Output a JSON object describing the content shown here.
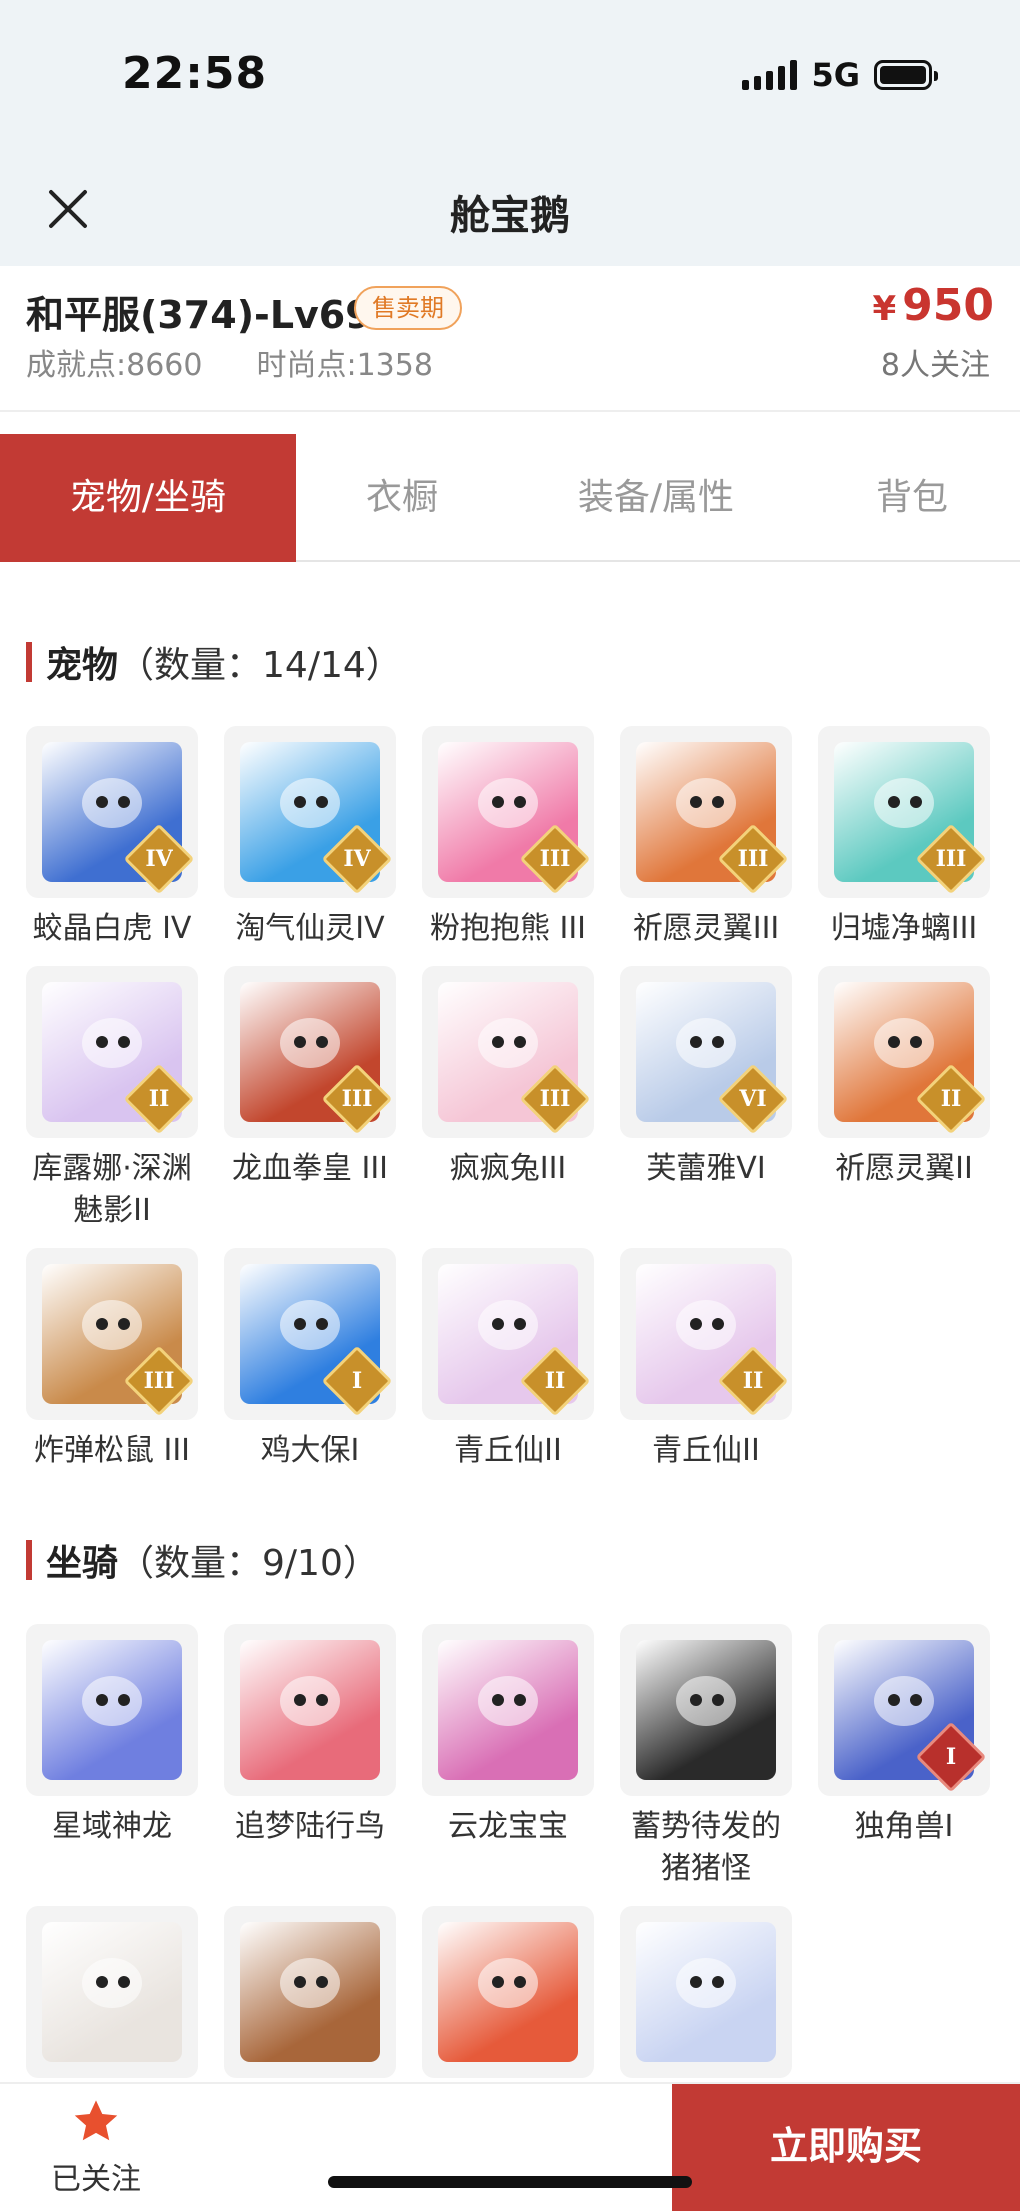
{
  "status_bar": {
    "time": "22:58",
    "network": "5G"
  },
  "nav": {
    "title": "舱宝鹅"
  },
  "listing": {
    "server_title": "和平服(374)-Lv69",
    "status_badge": "售卖期",
    "achievement_label": "成就点:",
    "achievement_value": "8660",
    "fashion_label": "时尚点:",
    "fashion_value": "1358",
    "price_currency": "¥",
    "price": "950",
    "followers": "8人关注"
  },
  "tabs": [
    {
      "label": "宠物/坐骑",
      "active": true
    },
    {
      "label": "衣橱",
      "active": false
    },
    {
      "label": "装备/属性",
      "active": false
    },
    {
      "label": "背包",
      "active": false
    }
  ],
  "pets_section": {
    "name": "宠物",
    "count": "（数量：14/14）"
  },
  "pets": [
    {
      "name": "蛟晶白虎 IV",
      "grade": "IV",
      "color": "#3f6fd1"
    },
    {
      "name": "淘气仙灵IV",
      "grade": "IV",
      "color": "#3aa0e6"
    },
    {
      "name": "粉抱抱熊 III",
      "grade": "III",
      "color": "#f07aa8"
    },
    {
      "name": "祈愿灵翼III",
      "grade": "III",
      "color": "#e0763a"
    },
    {
      "name": "归墟净螭III",
      "grade": "III",
      "color": "#5cc9c0"
    },
    {
      "name": "库露娜·深渊魅影II",
      "grade": "II",
      "color": "#d9c4f0"
    },
    {
      "name": "龙血拳皇 III",
      "grade": "III",
      "color": "#c2462d"
    },
    {
      "name": "疯疯兔III",
      "grade": "III",
      "color": "#f5c6d6"
    },
    {
      "name": "芙蕾雅VI",
      "grade": "VI",
      "color": "#b9cbe8"
    },
    {
      "name": "祈愿灵翼II",
      "grade": "II",
      "color": "#e0763a"
    },
    {
      "name": "炸弹松鼠 III",
      "grade": "III",
      "color": "#c98a4a"
    },
    {
      "name": "鸡大保I",
      "grade": "I",
      "color": "#2f7fe0"
    },
    {
      "name": "青丘仙II",
      "grade": "II",
      "color": "#e6c8ec"
    },
    {
      "name": "青丘仙II",
      "grade": "II",
      "color": "#e6c8ec"
    }
  ],
  "mounts_section": {
    "name": "坐骑",
    "count": "（数量：9/10）"
  },
  "mounts": [
    {
      "name": "星域神龙",
      "grade": "",
      "color": "#6f7fe0"
    },
    {
      "name": "追梦陆行鸟",
      "grade": "",
      "color": "#e86b7a"
    },
    {
      "name": "云龙宝宝",
      "grade": "",
      "color": "#d96fb5"
    },
    {
      "name": "蓄势待发的猪猪怪",
      "grade": "",
      "color": "#2a2a2a"
    },
    {
      "name": "独角兽I",
      "grade": "I",
      "color": "#4a62c9"
    },
    {
      "name": "",
      "grade": "",
      "color": "#e9e4df"
    },
    {
      "name": "",
      "grade": "",
      "color": "#a8663a"
    },
    {
      "name": "",
      "grade": "",
      "color": "#e65a3a"
    },
    {
      "name": "",
      "grade": "",
      "color": "#c9d4f2"
    }
  ],
  "bottom_bar": {
    "follow_label": "已关注",
    "buy_label": "立即购买"
  }
}
